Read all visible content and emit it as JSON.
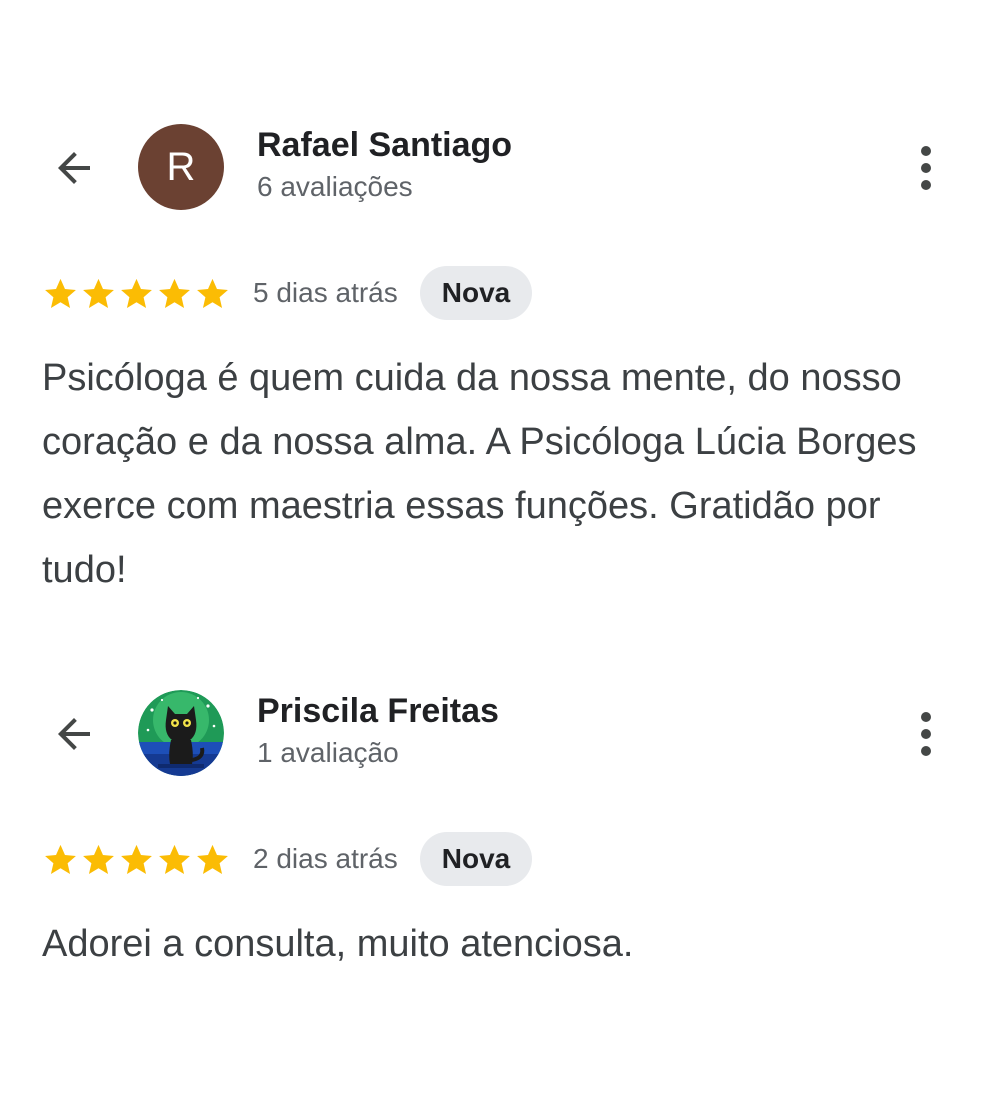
{
  "reviews": [
    {
      "author": "Rafael Santiago",
      "review_count": "6 avaliações",
      "avatar_letter": "R",
      "avatar_color": "#6b4132",
      "rating": 5,
      "date": "5 dias atrás",
      "badge": "Nova",
      "text": "Psicóloga é quem cuida da nossa mente, do nosso coração e da nossa alma. A Psicóloga Lúcia Borges exerce com maestria essas funções. Gratidão por tudo!"
    },
    {
      "author": "Priscila Freitas",
      "review_count": "1 avaliação",
      "avatar_icon": "cat-avatar-icon",
      "rating": 5,
      "date": "2 dias atrás",
      "badge": "Nova",
      "text": "Adorei a consulta, muito atenciosa."
    }
  ],
  "icons": {
    "back": "arrow-back-icon",
    "menu": "more-vert-icon",
    "star": "star-icon"
  },
  "colors": {
    "star": "#fbbc04",
    "badge_bg": "#e8eaed",
    "secondary_text": "#5f6368"
  }
}
